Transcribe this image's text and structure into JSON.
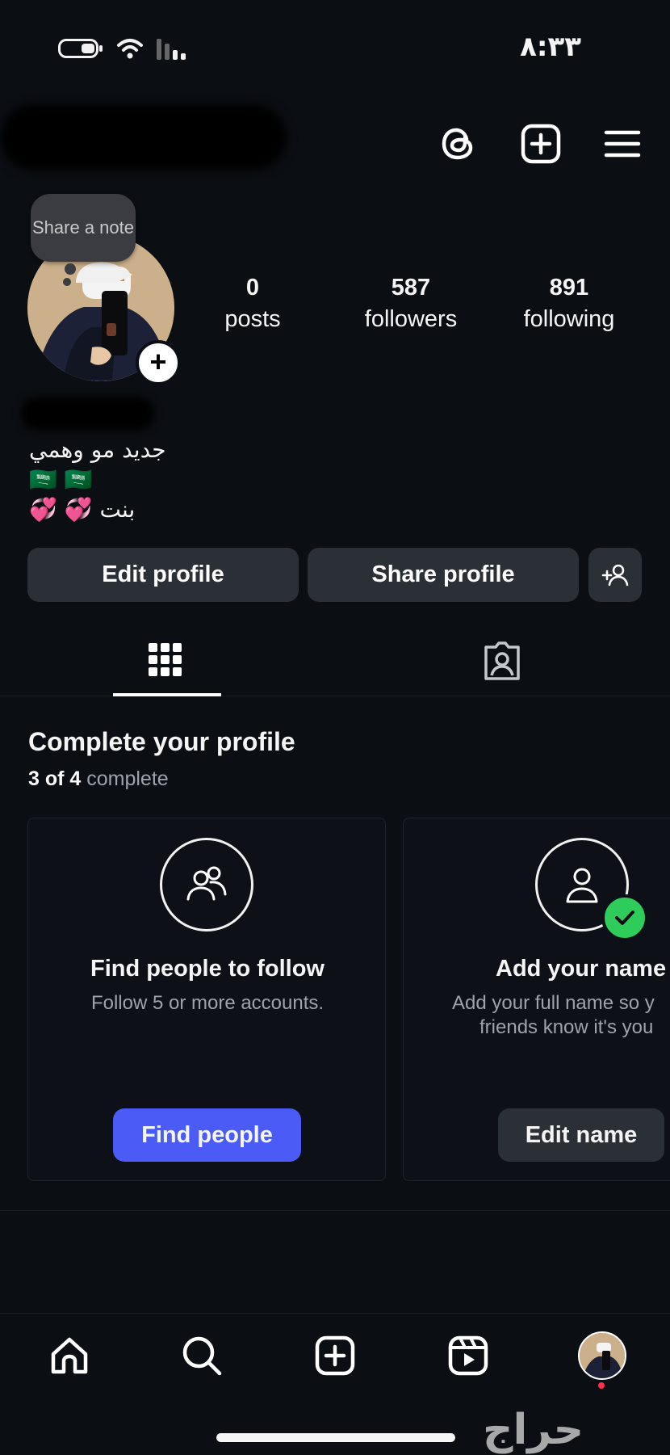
{
  "status_bar": {
    "time": "٨:٣٣"
  },
  "profile": {
    "note_bubble": "Share a note",
    "stats": [
      {
        "value": "0",
        "label": "posts"
      },
      {
        "value": "587",
        "label": "followers"
      },
      {
        "value": "891",
        "label": "following"
      }
    ],
    "bio_lines": [
      "جديد مو وهمي",
      "🇸🇦 🇸🇦",
      "بنت 💞 💞"
    ]
  },
  "actions": {
    "edit_profile": "Edit profile",
    "share_profile": "Share profile"
  },
  "tabs": [
    {
      "icon": "grid-icon",
      "active": true
    },
    {
      "icon": "tagged-person-icon",
      "active": false
    }
  ],
  "complete_profile": {
    "title": "Complete your profile",
    "progress_count": "3 of 4",
    "progress_word": "complete",
    "cards": [
      {
        "icon": "people-icon",
        "title": "Find people to follow",
        "description": "Follow 5 or more accounts.",
        "button": "Find people",
        "done": false
      },
      {
        "icon": "person-icon",
        "title": "Add your name",
        "description_line1": "Add your full name so y",
        "description_line2": "friends know it's you",
        "button": "Edit name",
        "done": true
      }
    ]
  },
  "bottom_nav": [
    "home-icon",
    "search-icon",
    "create-icon",
    "reels-icon",
    "profile-avatar"
  ],
  "watermark": "حراج",
  "colors": {
    "background": "#0b0e13",
    "button": "#2b2f36",
    "primary_button": "#4a5cf5",
    "check": "#2ecc5a",
    "notification_dot": "#ff2e4c"
  }
}
